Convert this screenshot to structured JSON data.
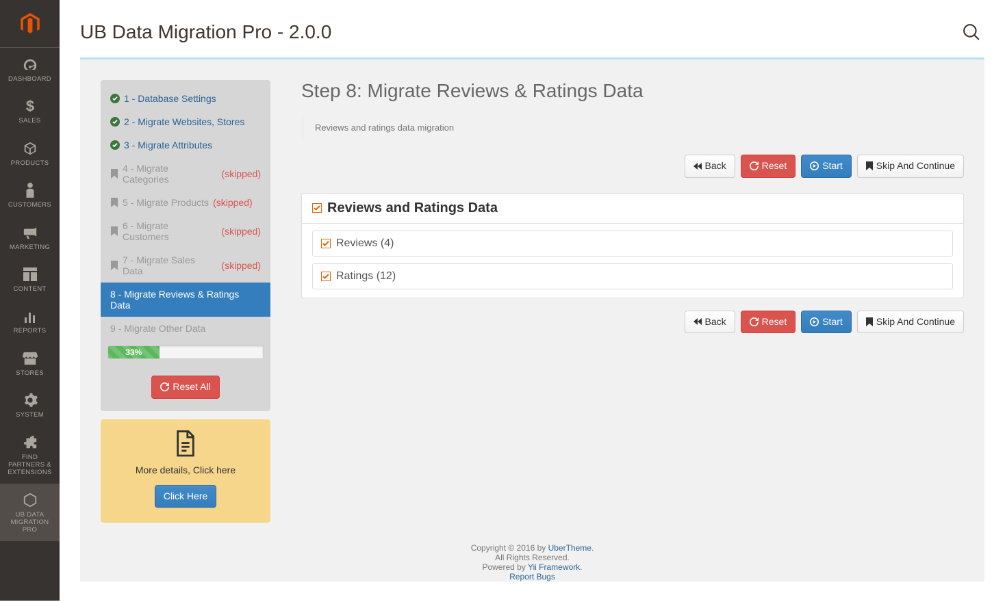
{
  "nav": {
    "items": [
      {
        "label": "DASHBOARD"
      },
      {
        "label": "SALES"
      },
      {
        "label": "PRODUCTS"
      },
      {
        "label": "CUSTOMERS"
      },
      {
        "label": "MARKETING"
      },
      {
        "label": "CONTENT"
      },
      {
        "label": "REPORTS"
      },
      {
        "label": "STORES"
      },
      {
        "label": "SYSTEM"
      },
      {
        "label": "FIND\nPARTNERS &\nEXTENSIONS"
      },
      {
        "label": "UB DATA\nMIGRATION\nPRO"
      }
    ]
  },
  "header": {
    "title": "UB Data Migration Pro - 2.0.0"
  },
  "steplist": {
    "items": [
      {
        "label": "1 - Database Settings",
        "status": "done"
      },
      {
        "label": "2 - Migrate Websites, Stores",
        "status": "done"
      },
      {
        "label": "3 - Migrate Attributes",
        "status": "done"
      },
      {
        "label": "4 - Migrate Categories",
        "status": "skipped",
        "skip": "(skipped)"
      },
      {
        "label": "5 - Migrate Products",
        "status": "skipped",
        "skip": "(skipped)"
      },
      {
        "label": "6 - Migrate Customers",
        "status": "skipped",
        "skip": "(skipped)"
      },
      {
        "label": "7 - Migrate Sales Data",
        "status": "skipped",
        "skip": "(skipped)"
      },
      {
        "label": "8 - Migrate Reviews & Ratings Data",
        "status": "active"
      },
      {
        "label": "9 - Migrate Other Data",
        "status": "pending"
      }
    ],
    "progress_label": "33%",
    "progress_pct": 33,
    "reset_all": "Reset All"
  },
  "details_card": {
    "text": "More details, Click here",
    "button": "Click Here"
  },
  "main_panel": {
    "heading": "Step 8: Migrate Reviews & Ratings Data",
    "notice": "Reviews and ratings data migration",
    "buttons": {
      "back": "Back",
      "reset": "Reset",
      "start": "Start",
      "skip": "Skip And Continue"
    },
    "data_panel": {
      "title": "Reviews and Ratings Data",
      "rows": [
        {
          "label": "Reviews (4)"
        },
        {
          "label": "Ratings (12)"
        }
      ]
    }
  },
  "footer": {
    "line1a": "Copyright © 2016 by ",
    "link1": "UberTheme",
    "line2": "All Rights Reserved.",
    "line3a": "Powered by ",
    "link3": "Yii Framework",
    "link4": "Report Bugs"
  }
}
